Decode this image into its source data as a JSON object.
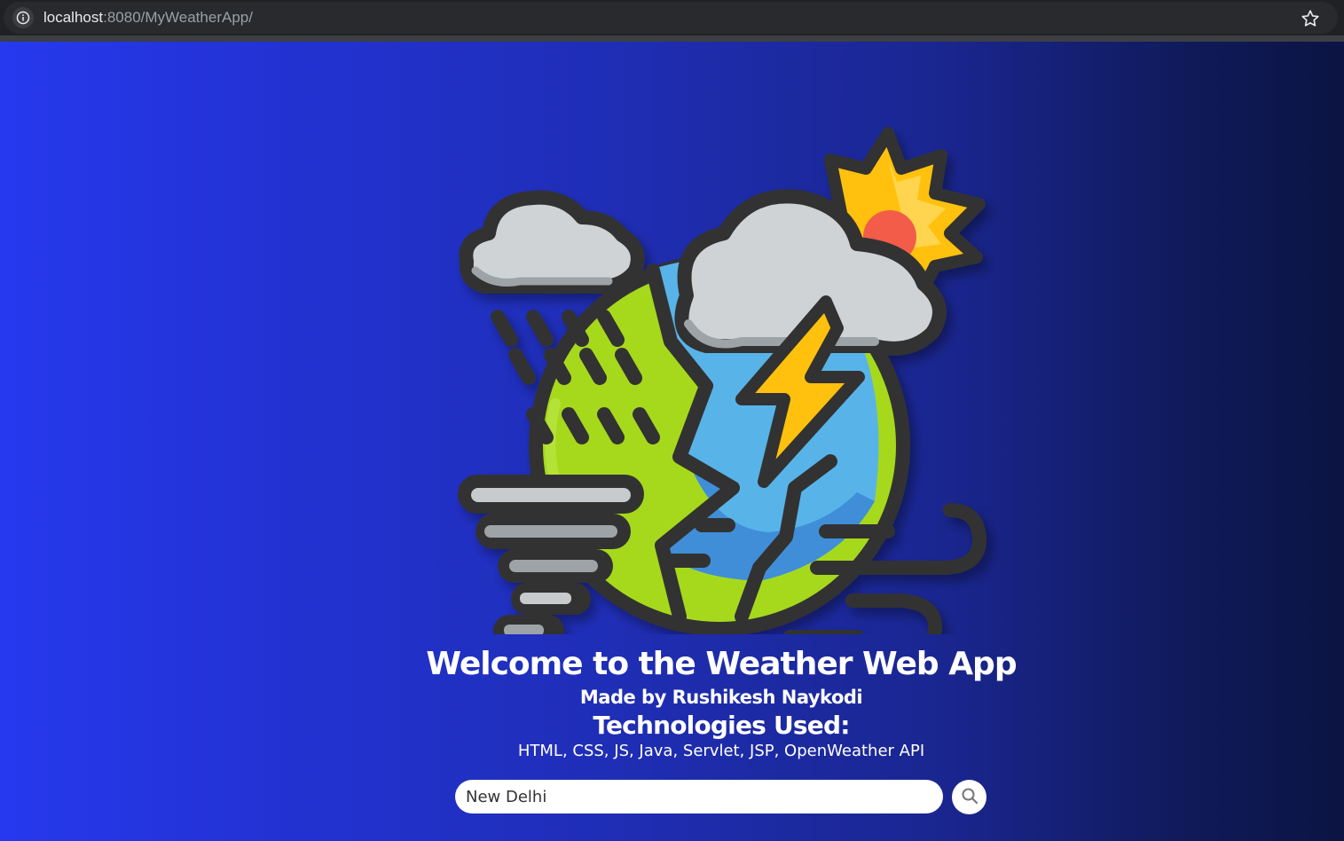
{
  "browser": {
    "url_host": "localhost",
    "url_rest": ":8080/MyWeatherApp/"
  },
  "hero": {
    "icon": "weather-globe-illustration"
  },
  "content": {
    "title": "Welcome to the Weather Web App",
    "author": "Made by Rushikesh Naykodi",
    "tech_heading": "Technologies Used:",
    "tech_list": "HTML, CSS, JS, Java, Servlet, JSP, OpenWeather API"
  },
  "search": {
    "value": "New Delhi",
    "button_icon": "search-icon"
  },
  "colors": {
    "gradient_left": "#2639ee",
    "gradient_right": "#0b1443",
    "outline": "#333333",
    "globe_green": "#a6d91e",
    "globe_blue": "#58b4e8",
    "sun": "#ffc107",
    "sun_core": "#f35b4a",
    "cloud": "#cfd3d6"
  }
}
